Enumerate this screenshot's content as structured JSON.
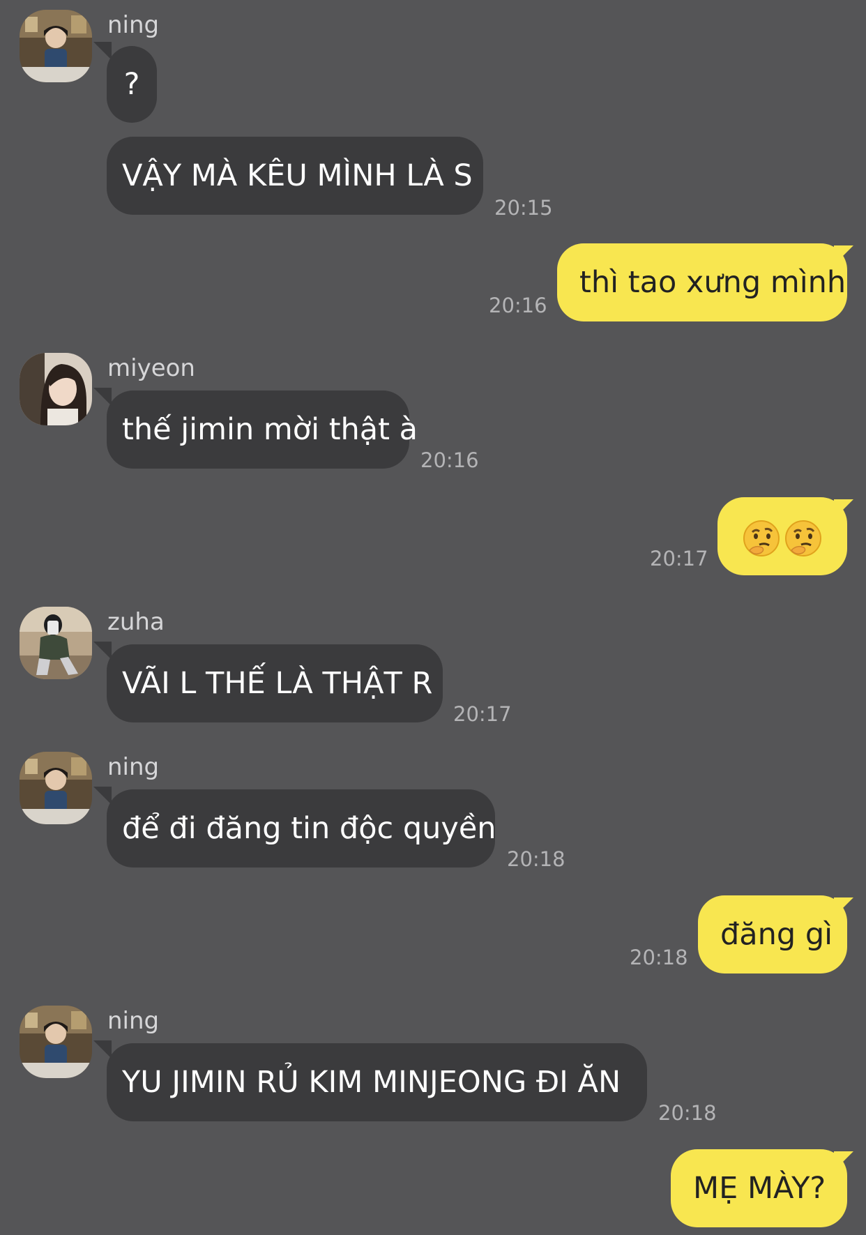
{
  "theme": {
    "background": "#555557",
    "incoming_bubble": "#3b3b3d",
    "outgoing_bubble": "#f8e650"
  },
  "messages": [
    {
      "sender": "ning",
      "text": "?",
      "avatar": "ning-avatar"
    },
    {
      "sender": "ning",
      "text": "VẬY MÀ KÊU MÌNH LÀ S",
      "time": "20:15"
    },
    {
      "sender": "me",
      "text": "thì tao xưng mình",
      "time": "20:16"
    },
    {
      "sender": "miyeon",
      "text": "thế jimin mời thật à",
      "time": "20:16",
      "avatar": "miyeon-avatar"
    },
    {
      "sender": "me",
      "emoji": [
        "thinking-face-emoji",
        "thinking-face-emoji"
      ],
      "time": "20:17"
    },
    {
      "sender": "zuha",
      "text": "VÃI L THẾ LÀ THẬT R",
      "time": "20:17",
      "avatar": "zuha-avatar"
    },
    {
      "sender": "ning",
      "text": "để đi đăng tin độc quyền",
      "time": "20:18",
      "avatar": "ning-avatar"
    },
    {
      "sender": "me",
      "text": "đăng gì",
      "time": "20:18"
    },
    {
      "sender": "ning",
      "text": "YU JIMIN RỦ KIM MINJEONG ĐI ĂN",
      "time": "20:18",
      "avatar": "ning-avatar"
    },
    {
      "sender": "me",
      "text": "MẸ MÀY?"
    }
  ]
}
